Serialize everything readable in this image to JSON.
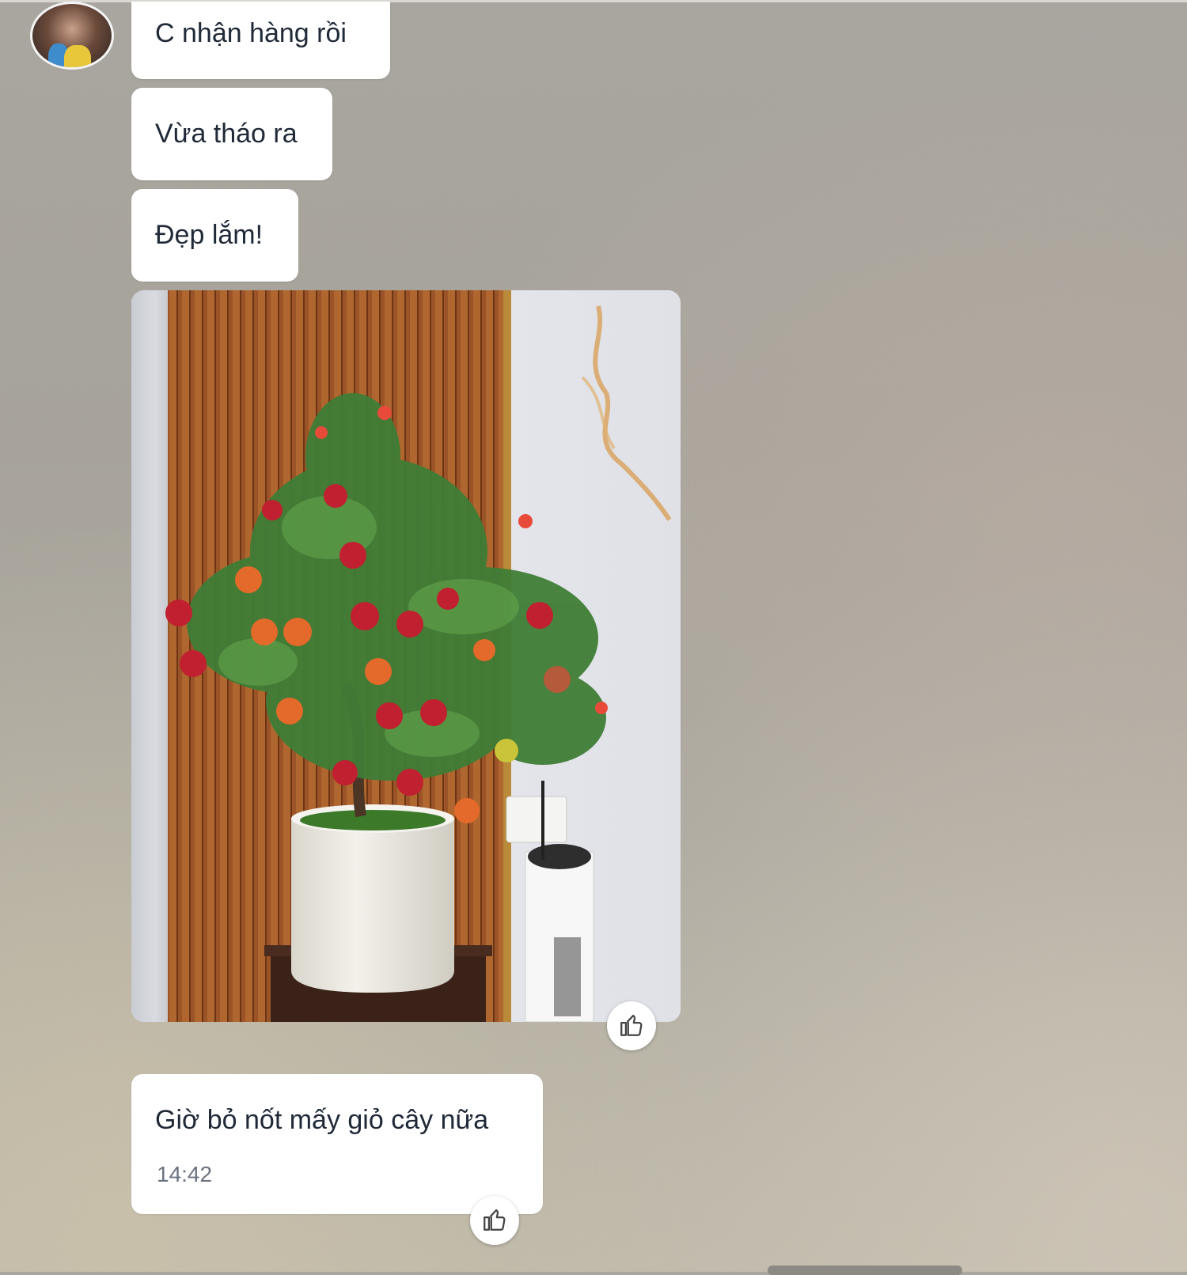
{
  "conversation": {
    "messages": [
      {
        "text": "C nhận hàng rồi"
      },
      {
        "text": "Vừa tháo ra"
      },
      {
        "text": "Đẹp lắm!"
      },
      {
        "text": "Giờ bỏ nốt mấy giỏ cây nữa",
        "time": "14:42"
      }
    ],
    "photo": {
      "alt": "Chậu cây lựu giả trong chậu trắng"
    },
    "reaction_icon": "thumbs-up-icon"
  }
}
